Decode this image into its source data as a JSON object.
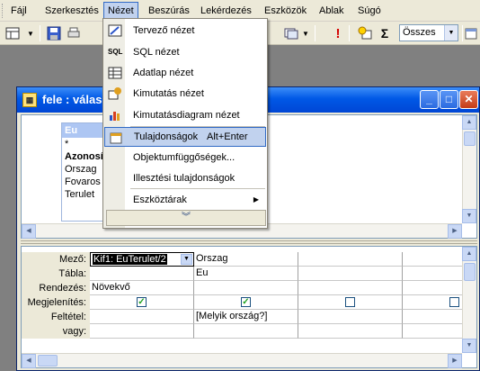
{
  "menubar": {
    "items": [
      "Fájl",
      "Szerkesztés",
      "Nézet",
      "Beszúrás",
      "Lekérdezés",
      "Eszközök",
      "Ablak",
      "Súgó"
    ]
  },
  "toolbar": {
    "combo_value": "Összes",
    "icons": [
      "view-icon",
      "save-icon",
      "print-icon",
      "query-type-icon",
      "run-icon",
      "show-table-icon",
      "totals-icon",
      "properties-icon"
    ]
  },
  "view_menu": {
    "items": [
      {
        "label": "Tervező nézet",
        "icon": "design-view-icon"
      },
      {
        "label": "SQL nézet",
        "icon": "sql-view-icon"
      },
      {
        "label": "Adatlap nézet",
        "icon": "datasheet-view-icon"
      },
      {
        "label": "Kimutatás nézet",
        "icon": "pivottable-icon"
      },
      {
        "label": "Kimutatásdiagram nézet",
        "icon": "pivotchart-icon"
      },
      {
        "label": "Tulajdonságok",
        "shortcut": "Alt+Enter",
        "icon": "properties-icon"
      },
      {
        "label": "Objektumfüggőségek...",
        "icon": ""
      },
      {
        "label": "Illesztési tulajdonságok",
        "icon": ""
      },
      {
        "label": "Eszköztárak",
        "icon": ""
      }
    ]
  },
  "query_window": {
    "title": "fele : válas",
    "table": {
      "name": "Eu",
      "fields": [
        "*",
        "Azonosító",
        "Orszag",
        "Fovaros",
        "Terulet"
      ]
    },
    "grid": {
      "row_headers": [
        "Mező:",
        "Tábla:",
        "Rendezés:",
        "Megjelenítés:",
        "Feltétel:",
        "vagy:"
      ],
      "col1": {
        "field": "Kif1: EuTerulet/2",
        "table": "",
        "sort": "Növekvő",
        "show": true,
        "criteria": ""
      },
      "col2": {
        "field": "Orszag",
        "table": "Eu",
        "sort": "",
        "show": true,
        "criteria": "[Melyik ország?]"
      },
      "col3": {
        "show": false
      },
      "col4": {
        "show": false
      }
    }
  }
}
